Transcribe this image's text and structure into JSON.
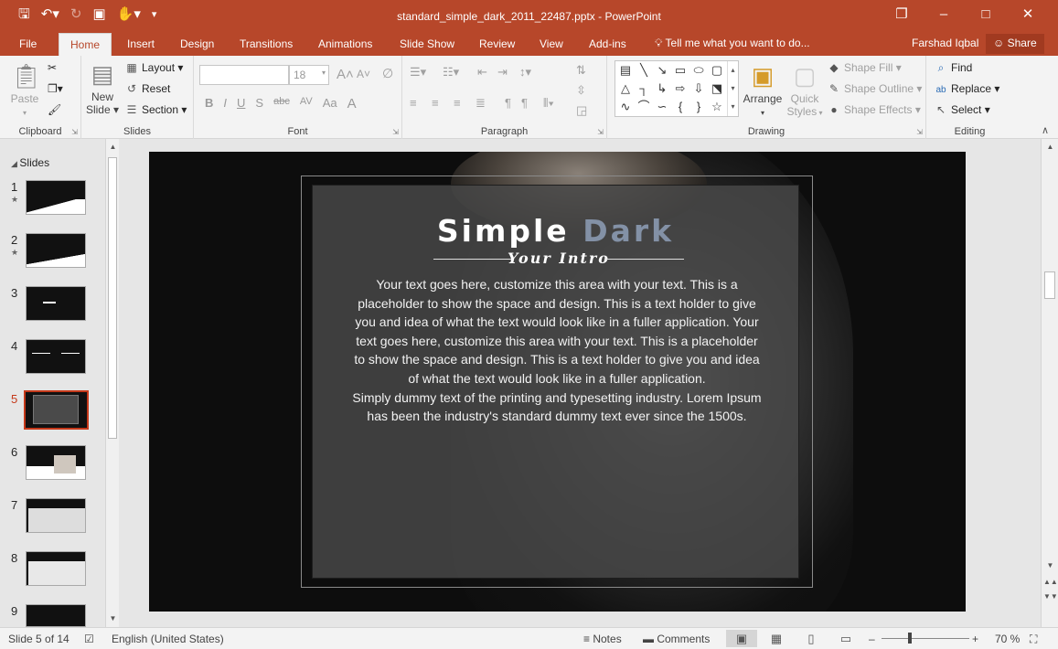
{
  "window": {
    "title": "standard_simple_dark_2011_22487.pptx - PowerPoint",
    "controls": [
      "ribbon-display-icon",
      "minimize-icon",
      "maximize-icon",
      "close-icon"
    ]
  },
  "quick_access": [
    "save-icon",
    "undo-icon",
    "redo-icon",
    "present-from-start-icon",
    "touch-mode-icon",
    "customize-qat-icon"
  ],
  "tabs": [
    {
      "label": "File",
      "active": false
    },
    {
      "label": "Home",
      "active": true
    },
    {
      "label": "Insert",
      "active": false
    },
    {
      "label": "Design",
      "active": false
    },
    {
      "label": "Transitions",
      "active": false
    },
    {
      "label": "Animations",
      "active": false
    },
    {
      "label": "Slide Show",
      "active": false
    },
    {
      "label": "Review",
      "active": false
    },
    {
      "label": "View",
      "active": false
    },
    {
      "label": "Add-ins",
      "active": false
    }
  ],
  "tell_me": "Tell me what you want to do...",
  "user_name": "Farshad Iqbal",
  "share_label": "Share",
  "ribbon": {
    "clipboard": {
      "paste": "Paste",
      "group": "Clipboard"
    },
    "slides": {
      "new_slide_1": "New",
      "new_slide_2": "Slide",
      "layout": "Layout",
      "reset": "Reset",
      "section": "Section",
      "group": "Slides"
    },
    "font": {
      "font_name": "",
      "font_size": "18",
      "bold": "B",
      "italic": "I",
      "underline": "U",
      "shadow": "S",
      "strike": "abc",
      "spacing": "AV",
      "case": "Aa",
      "color": "A",
      "grow": "A",
      "shrink": "A",
      "group": "Font"
    },
    "paragraph": {
      "group": "Paragraph"
    },
    "drawing": {
      "arrange_1": "Arrange",
      "quick_1": "Quick",
      "quick_2": "Styles",
      "shape_fill": "Shape Fill",
      "shape_outline": "Shape Outline",
      "shape_effects": "Shape Effects",
      "group": "Drawing"
    },
    "editing": {
      "find": "Find",
      "replace": "Replace",
      "select": "Select",
      "group": "Editing"
    }
  },
  "slides_panel": {
    "header": "Slides",
    "items": [
      {
        "num": "1",
        "star": true
      },
      {
        "num": "2",
        "star": true
      },
      {
        "num": "3",
        "star": false
      },
      {
        "num": "4",
        "star": false
      },
      {
        "num": "5",
        "star": false,
        "selected": true
      },
      {
        "num": "6",
        "star": false
      },
      {
        "num": "7",
        "star": false
      },
      {
        "num": "8",
        "star": false
      },
      {
        "num": "9",
        "star": false
      }
    ]
  },
  "slide": {
    "title_main": "Simple",
    "title_accent": "Dark",
    "subtitle": "Your Intro",
    "body": "Your text goes here, customize this area with your text. This is a placeholder to show the space and design. This is a text holder to give you and idea of what the text would look like in a fuller application. Your text goes here, customize this area with your text. This is a placeholder to show the space and design. This is a text holder to give you and idea of what the text would look like in a fuller application.",
    "body2": "Simply dummy text of the printing and typesetting industry. Lorem Ipsum has been the industry's standard dummy text ever since the 1500s."
  },
  "status": {
    "slide_of": "Slide 5 of 14",
    "language": "English (United States)",
    "notes": "Notes",
    "comments": "Comments",
    "zoom": "70 %"
  },
  "colors": {
    "accent": "#b7472a",
    "title_accent": "#8391a6",
    "selection": "#c5391a"
  }
}
